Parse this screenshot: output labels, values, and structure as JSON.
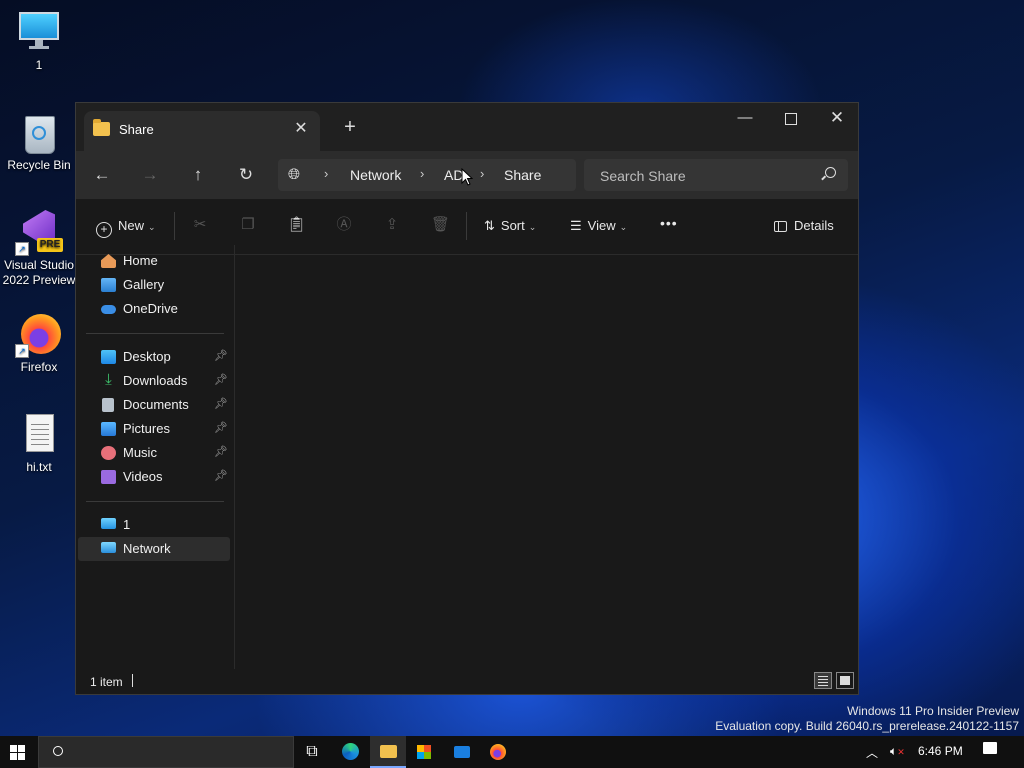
{
  "desktop": {
    "icons": [
      {
        "label": "1",
        "icon": "monitor-icon"
      },
      {
        "label": "Recycle Bin",
        "icon": "recycle-bin-icon"
      },
      {
        "label": "Visual Studio 2022 Preview",
        "badge": "PRE",
        "icon": "visual-studio-icon"
      },
      {
        "label": "Firefox",
        "icon": "firefox-icon"
      },
      {
        "label": "hi.txt",
        "icon": "text-file-icon"
      }
    ]
  },
  "explorer": {
    "tab_title": "Share",
    "address": {
      "crumbs": [
        "Network",
        "AD",
        "Share"
      ]
    },
    "search": {
      "placeholder": "Search Share"
    },
    "toolbar": {
      "new_label": "New",
      "sort_label": "Sort",
      "view_label": "View",
      "more_label": "•••",
      "details_label": "Details"
    },
    "sidebar": {
      "top": [
        {
          "label": "Home",
          "icon": "home-icon"
        },
        {
          "label": "Gallery",
          "icon": "gallery-icon"
        },
        {
          "label": "OneDrive",
          "icon": "onedrive-icon"
        }
      ],
      "pinned": [
        {
          "label": "Desktop",
          "icon": "desktop-folder-icon"
        },
        {
          "label": "Downloads",
          "icon": "downloads-icon"
        },
        {
          "label": "Documents",
          "icon": "documents-icon"
        },
        {
          "label": "Pictures",
          "icon": "pictures-icon"
        },
        {
          "label": "Music",
          "icon": "music-icon"
        },
        {
          "label": "Videos",
          "icon": "videos-icon"
        }
      ],
      "devices": [
        {
          "label": "1",
          "icon": "pc-icon"
        },
        {
          "label": "Network",
          "icon": "network-icon",
          "selected": true
        }
      ]
    },
    "status": {
      "item_count": "1 item"
    }
  },
  "watermark": {
    "line1": "Windows 11 Pro Insider Preview",
    "line2": "Evaluation copy. Build 26040.rs_prerelease.240122-1157"
  },
  "taskbar": {
    "time": "6:46 PM",
    "apps": [
      "task-view-icon",
      "edge-icon",
      "file-explorer-icon",
      "store-icon",
      "mail-icon",
      "firefox-icon"
    ]
  }
}
